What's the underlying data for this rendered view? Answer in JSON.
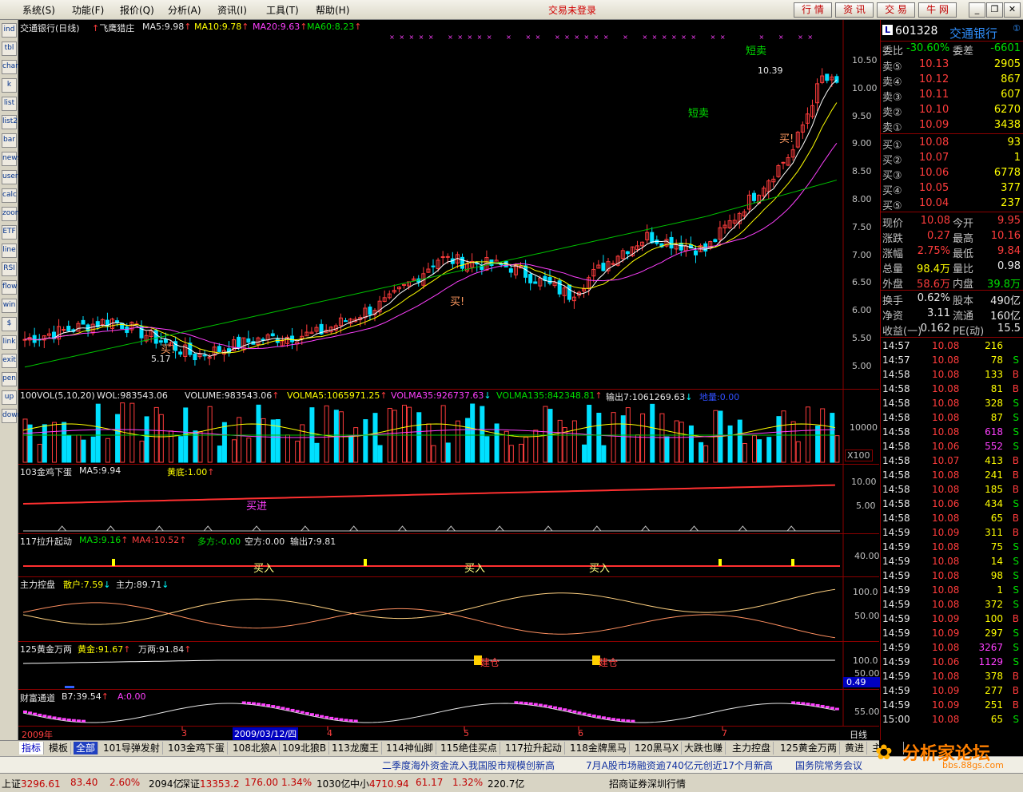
{
  "menubar": {
    "items": [
      "系统(S)",
      "功能(F)",
      "报价(Q)",
      "分析(A)",
      "资讯(I)",
      "工具(T)",
      "帮助(H)"
    ],
    "status_title": "交易未登录",
    "buttons": [
      "行 情",
      "资 讯",
      "交 易",
      "牛 网"
    ]
  },
  "left_toolbar": [
    "ind",
    "tbl",
    "chart",
    "k",
    "list",
    "list2",
    "bar",
    "news",
    "user",
    "calc",
    "zoom",
    "ETF",
    "line",
    "RSI",
    "flow",
    "win",
    "$",
    "link",
    "exit",
    "pen",
    "up",
    "down"
  ],
  "main_chart": {
    "title": "交通银行(日线)",
    "indicator": "飞鹰猎庄",
    "ma5": "MA5:9.98",
    "ma10": "MA10:9.78",
    "ma20": "MA20:9.63",
    "ma60": "MA60:8.23",
    "annotations": {
      "short_sell_1": "短卖",
      "short_sell_2": "短卖",
      "high": "10.39",
      "low": "5.17",
      "buy_1": "买!",
      "buy_2": "买!",
      "buy_3": "买!"
    },
    "yaxis": [
      "10.50",
      "10.00",
      "9.50",
      "9.00",
      "8.50",
      "8.00",
      "7.50",
      "7.00",
      "6.50",
      "6.00",
      "5.50",
      "5.00"
    ]
  },
  "volume_pane": {
    "title": "100VOL(5,10,20)",
    "wol": "WOL:983543.06",
    "volume": "VOLUME:983543.06",
    "volma5": "VOLMA5:1065971.25",
    "volma35": "VOLMA35:926737.63",
    "volma135": "VOLMA135:842348.81",
    "out7": "输出7:1061269.63",
    "bottom": "地量:0.00",
    "axis": "10000",
    "unit": "X100"
  },
  "pane103": {
    "title": "103金鸡下蛋",
    "ma5": "MA5:9.94",
    "bottom": "黄底:1.00",
    "buy": "买进",
    "axis": [
      "10.00",
      "5.00"
    ]
  },
  "pane117": {
    "title": "117拉升起动",
    "ma3": "MA3:9.16",
    "ma4": "MA4:10.52",
    "duo": "多方:-0.00",
    "kong": "空方:0.00",
    "out": "输出7:9.81",
    "buy": "买入",
    "axis": [
      "40.00"
    ]
  },
  "pane_main": {
    "title": "主力控盘",
    "retail": "散户:7.59",
    "main": "主力:89.71",
    "axis": [
      "100.0",
      "50.00"
    ]
  },
  "pane125": {
    "title": "125黄金万两",
    "gold": "黄金:91.67",
    "wan": "万两:91.84",
    "axis": [
      "100.0",
      "50.00"
    ],
    "value": "0.49",
    "tag": "建仓"
  },
  "pane_wealth": {
    "title": "财富通道",
    "b7": "B7:39.54",
    "a": "A:0.00",
    "axis": [
      "55.00"
    ]
  },
  "xaxis": {
    "year": "2009年",
    "m3": "3",
    "date": "2009/03/12/四",
    "m4": "4",
    "m5": "5",
    "m6": "6",
    "m7": "7",
    "period": "日线"
  },
  "quote": {
    "code": "601328",
    "name": "交通银行",
    "weibi_label": "委比",
    "weibi": "-30.60%",
    "weicha_label": "委差",
    "weicha": "-6601",
    "sell": [
      {
        "label": "卖⑤",
        "price": "10.13",
        "vol": "2905"
      },
      {
        "label": "卖④",
        "price": "10.12",
        "vol": "867"
      },
      {
        "label": "卖③",
        "price": "10.11",
        "vol": "607"
      },
      {
        "label": "卖②",
        "price": "10.10",
        "vol": "6270"
      },
      {
        "label": "卖①",
        "price": "10.09",
        "vol": "3438"
      }
    ],
    "buy": [
      {
        "label": "买①",
        "price": "10.08",
        "vol": "93"
      },
      {
        "label": "买②",
        "price": "10.07",
        "vol": "1"
      },
      {
        "label": "买③",
        "price": "10.06",
        "vol": "6778"
      },
      {
        "label": "买④",
        "price": "10.05",
        "vol": "377"
      },
      {
        "label": "买⑤",
        "price": "10.04",
        "vol": "237"
      }
    ],
    "stats": [
      {
        "l1": "现价",
        "v1": "10.08",
        "l2": "今开",
        "v2": "9.95"
      },
      {
        "l1": "涨跌",
        "v1": "0.27",
        "l2": "最高",
        "v2": "10.16"
      },
      {
        "l1": "涨幅",
        "v1": "2.75%",
        "l2": "最低",
        "v2": "9.84"
      },
      {
        "l1": "总量",
        "v1": "98.4万",
        "l2": "量比",
        "v2": "0.98"
      },
      {
        "l1": "外盘",
        "v1": "58.6万",
        "l2": "内盘",
        "v2": "39.8万"
      },
      {
        "l1": "换手",
        "v1": "0.62%",
        "l2": "股本",
        "v2": "490亿"
      },
      {
        "l1": "净资",
        "v1": "3.11",
        "l2": "流通",
        "v2": "160亿"
      },
      {
        "l1": "收益(一)",
        "v1": "0.162",
        "l2": "PE(动)",
        "v2": "15.5"
      }
    ],
    "ticks": [
      {
        "t": "14:57",
        "p": "10.08",
        "v": "216",
        "s": ""
      },
      {
        "t": "14:57",
        "p": "10.08",
        "v": "78",
        "s": "S"
      },
      {
        "t": "14:58",
        "p": "10.08",
        "v": "133",
        "s": "B"
      },
      {
        "t": "14:58",
        "p": "10.08",
        "v": "81",
        "s": "B"
      },
      {
        "t": "14:58",
        "p": "10.08",
        "v": "328",
        "s": "S"
      },
      {
        "t": "14:58",
        "p": "10.08",
        "v": "87",
        "s": "S"
      },
      {
        "t": "14:58",
        "p": "10.08",
        "v": "618",
        "s": "S"
      },
      {
        "t": "14:58",
        "p": "10.06",
        "v": "552",
        "s": "S"
      },
      {
        "t": "14:58",
        "p": "10.07",
        "v": "413",
        "s": "B"
      },
      {
        "t": "14:58",
        "p": "10.08",
        "v": "241",
        "s": "B"
      },
      {
        "t": "14:58",
        "p": "10.08",
        "v": "185",
        "s": "B"
      },
      {
        "t": "14:58",
        "p": "10.06",
        "v": "434",
        "s": "S"
      },
      {
        "t": "14:58",
        "p": "10.08",
        "v": "65",
        "s": "B"
      },
      {
        "t": "14:59",
        "p": "10.09",
        "v": "311",
        "s": "B"
      },
      {
        "t": "14:59",
        "p": "10.08",
        "v": "75",
        "s": "S"
      },
      {
        "t": "14:59",
        "p": "10.08",
        "v": "14",
        "s": "S"
      },
      {
        "t": "14:59",
        "p": "10.08",
        "v": "98",
        "s": "S"
      },
      {
        "t": "14:59",
        "p": "10.08",
        "v": "1",
        "s": "S"
      },
      {
        "t": "14:59",
        "p": "10.08",
        "v": "372",
        "s": "S"
      },
      {
        "t": "14:59",
        "p": "10.09",
        "v": "100",
        "s": "B"
      },
      {
        "t": "14:59",
        "p": "10.09",
        "v": "297",
        "s": "S"
      },
      {
        "t": "14:59",
        "p": "10.08",
        "v": "3267",
        "s": "S"
      },
      {
        "t": "14:59",
        "p": "10.06",
        "v": "1129",
        "s": "S"
      },
      {
        "t": "14:59",
        "p": "10.08",
        "v": "378",
        "s": "B"
      },
      {
        "t": "14:59",
        "p": "10.09",
        "v": "277",
        "s": "B"
      },
      {
        "t": "14:59",
        "p": "10.09",
        "v": "251",
        "s": "B"
      },
      {
        "t": "15:00",
        "p": "10.08",
        "v": "65",
        "s": "S"
      }
    ]
  },
  "tabs": [
    "指标",
    "模板",
    "全部",
    "101导弹发射",
    "103金鸡下蛋",
    "108北狼A",
    "109北狼B",
    "113龙魔王",
    "114神仙脚",
    "115绝佳买点",
    "117拉升起动",
    "118金牌黑马",
    "120黑马X",
    "大跌也赚",
    "主力控盘",
    "125黄金万两",
    "黄进",
    "主力线"
  ],
  "news": [
    "二季度海外资金流入我国股市规模创新高",
    "7月A股市场融资逾740亿元创近17个月新高",
    "国务院常务会议"
  ],
  "status": {
    "sh_label": "上证",
    "sh_val": "3296.61",
    "sh_chg": "83.40",
    "sh_pct": "2.60%",
    "sh_amt": "2094亿",
    "sz_label": "深证",
    "sz_val": "13353.2",
    "sz_chg": "176.00",
    "sz_pct": "1.34%",
    "sz_amt": "1030亿",
    "zx_label": "中小",
    "zx_val": "4710.94",
    "zx_chg": "61.17",
    "zx_pct": "1.32%",
    "zx_amt": "220.7亿",
    "broker": "招商证券深圳行情"
  },
  "watermark": {
    "title": "分析家论坛",
    "url": "bbs.88gs.com"
  },
  "colors": {
    "up": "#ff3c3c",
    "down": "#00e0ff",
    "ma5": "#ffffff",
    "ma10": "#ffff00",
    "ma20": "#ff40ff",
    "ma60": "#00c000"
  }
}
